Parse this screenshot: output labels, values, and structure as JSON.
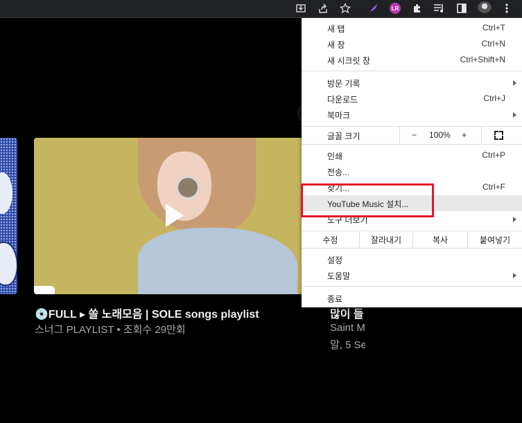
{
  "toolbar": {
    "icons": [
      "install-icon",
      "share-icon",
      "bookmark-star-icon",
      "feather-extension-icon",
      "lr-extension-icon",
      "extensions-puzzle-icon",
      "media-control-icon",
      "side-panel-icon",
      "profile-avatar",
      "more-menu-icon"
    ],
    "lr_text": "LR"
  },
  "content": {
    "video_title": "💿FULL ▸ 쏠 노래모음 | SOLE songs playlist",
    "video_channel": "스너그 PLAYLIST • 조회수 29만회",
    "right_title": "많이 들",
    "right_meta1": "Saint M",
    "right_meta2": "알, 5 Se"
  },
  "menu": {
    "new_tab": {
      "label": "새 탭",
      "shortcut": "Ctrl+T"
    },
    "new_window": {
      "label": "새 창",
      "shortcut": "Ctrl+N"
    },
    "incognito": {
      "label": "새 시크릿 창",
      "shortcut": "Ctrl+Shift+N"
    },
    "history": {
      "label": "방문 기록"
    },
    "downloads": {
      "label": "다운로드",
      "shortcut": "Ctrl+J"
    },
    "bookmarks": {
      "label": "북마크"
    },
    "zoom": {
      "label": "글꼴 크기",
      "minus": "−",
      "value": "100%",
      "plus": "+"
    },
    "print": {
      "label": "인쇄",
      "shortcut": "Ctrl+P"
    },
    "cast": {
      "label": "전송..."
    },
    "find": {
      "label": "찾기...",
      "shortcut": "Ctrl+F"
    },
    "install": {
      "label": "YouTube Music 설치..."
    },
    "more_tools": {
      "label": "도구 더보기"
    },
    "edit": {
      "label": "수정",
      "cut": "잘라내기",
      "copy": "복사",
      "paste": "붙여넣기"
    },
    "settings": {
      "label": "설정"
    },
    "help": {
      "label": "도움말"
    },
    "exit": {
      "label": "종료"
    }
  },
  "colors": {
    "highlight_box": "#e0182a",
    "menu_bg": "#ffffff",
    "page_bg": "#000000"
  }
}
